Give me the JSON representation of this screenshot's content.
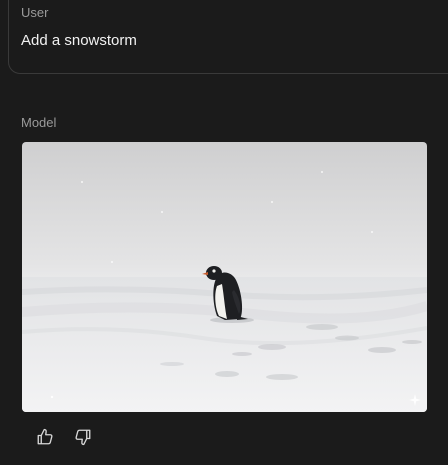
{
  "conversation": {
    "user_turn": {
      "role_label": "User",
      "message": "Add a snowstorm"
    },
    "model_turn": {
      "role_label": "Model",
      "image": {
        "subject": "penguin standing on snow in a snowstorm",
        "icon": "sparkle-icon"
      },
      "feedback": {
        "thumbs_up_icon": "thumbs-up-icon",
        "thumbs_down_icon": "thumbs-down-icon"
      }
    }
  },
  "colors": {
    "background": "#1b1b1b",
    "card_border": "#3a3a3a",
    "label": "#9a9a9a",
    "text": "#f1f1f1"
  }
}
